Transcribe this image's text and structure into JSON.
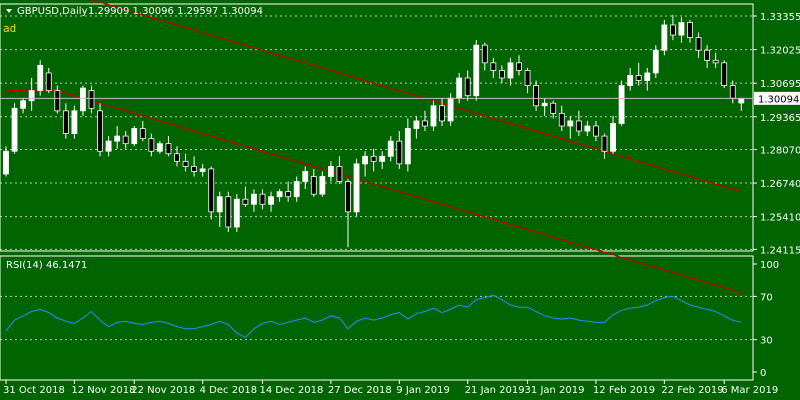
{
  "header": {
    "symbol_label": "GBPUSD,Daily",
    "ohlc_label": "1.29909 1.30096 1.29597 1.30094",
    "watermark": "ad"
  },
  "price_axis": {
    "ticks": [
      "1.33355",
      "1.32025",
      "1.30695",
      "1.29365",
      "1.28070",
      "1.26740",
      "1.25410",
      "1.24115"
    ],
    "current_price": "1.30094"
  },
  "rsi_panel": {
    "title": "RSI(14) 46.1471",
    "ticks": [
      "100",
      "70",
      "30",
      "0"
    ]
  },
  "date_axis": {
    "ticks": [
      "31 Oct 2018",
      "12 Nov 2018",
      "22 Nov 2018",
      "4 Dec 2018",
      "14 Dec 2018",
      "27 Dec 2018",
      "9 Jan 2019",
      "21 Jan 2019",
      "31 Jan 2019",
      "12 Feb 2019",
      "22 Feb 2019",
      "6 Mar 2019"
    ]
  },
  "colors": {
    "background": "#006400",
    "bull_candle": "#ffffff",
    "bear_candle": "#000000",
    "grid": "#ffffff",
    "ma": "#c80000",
    "rsi_line": "#1e90ff",
    "price_label_bg": "#ffffff",
    "price_label_text": "#000000"
  },
  "chart_data": [
    {
      "type": "candlestick",
      "symbol": "GBPUSD",
      "timeframe": "Daily",
      "ylim": [
        1.2405,
        1.3383
      ],
      "candles": [
        [
          1.271,
          1.282,
          1.27,
          1.28
        ],
        [
          1.28,
          1.299,
          1.279,
          1.297
        ],
        [
          1.297,
          1.301,
          1.295,
          1.3
        ],
        [
          1.3,
          1.309,
          1.296,
          1.304
        ],
        [
          1.304,
          1.316,
          1.302,
          1.314
        ],
        [
          1.311,
          1.313,
          1.303,
          1.304
        ],
        [
          1.304,
          1.306,
          1.295,
          1.296
        ],
        [
          1.296,
          1.299,
          1.285,
          1.287
        ],
        [
          1.287,
          1.298,
          1.285,
          1.296
        ],
        [
          1.296,
          1.306,
          1.294,
          1.305
        ],
        [
          1.304,
          1.306,
          1.295,
          1.297
        ],
        [
          1.296,
          1.299,
          1.278,
          1.28
        ],
        [
          1.28,
          1.286,
          1.278,
          1.284
        ],
        [
          1.284,
          1.29,
          1.281,
          1.286
        ],
        [
          1.286,
          1.288,
          1.281,
          1.283
        ],
        [
          1.283,
          1.29,
          1.282,
          1.289
        ],
        [
          1.289,
          1.292,
          1.284,
          1.285
        ],
        [
          1.285,
          1.287,
          1.278,
          1.28
        ],
        [
          1.28,
          1.284,
          1.279,
          1.283
        ],
        [
          1.283,
          1.286,
          1.278,
          1.279
        ],
        [
          1.279,
          1.282,
          1.274,
          1.276
        ],
        [
          1.276,
          1.279,
          1.272,
          1.274
        ],
        [
          1.274,
          1.278,
          1.27,
          1.272
        ],
        [
          1.272,
          1.275,
          1.27,
          1.273
        ],
        [
          1.273,
          1.274,
          1.253,
          1.256
        ],
        [
          1.256,
          1.264,
          1.25,
          1.262
        ],
        [
          1.262,
          1.264,
          1.248,
          1.25
        ],
        [
          1.25,
          1.263,
          1.248,
          1.261
        ],
        [
          1.261,
          1.266,
          1.258,
          1.259
        ],
        [
          1.259,
          1.265,
          1.256,
          1.263
        ],
        [
          1.263,
          1.265,
          1.257,
          1.259
        ],
        [
          1.259,
          1.264,
          1.256,
          1.262
        ],
        [
          1.262,
          1.265,
          1.26,
          1.264
        ],
        [
          1.264,
          1.268,
          1.26,
          1.262
        ],
        [
          1.262,
          1.27,
          1.26,
          1.268
        ],
        [
          1.268,
          1.274,
          1.265,
          1.272
        ],
        [
          1.27,
          1.273,
          1.262,
          1.263
        ],
        [
          1.263,
          1.272,
          1.262,
          1.27
        ],
        [
          1.27,
          1.276,
          1.268,
          1.274
        ],
        [
          1.274,
          1.278,
          1.267,
          1.268
        ],
        [
          1.268,
          1.269,
          1.242,
          1.256
        ],
        [
          1.256,
          1.277,
          1.254,
          1.275
        ],
        [
          1.275,
          1.28,
          1.27,
          1.278
        ],
        [
          1.278,
          1.281,
          1.272,
          1.276
        ],
        [
          1.276,
          1.28,
          1.273,
          1.278
        ],
        [
          1.278,
          1.286,
          1.276,
          1.284
        ],
        [
          1.284,
          1.288,
          1.273,
          1.275
        ],
        [
          1.275,
          1.293,
          1.272,
          1.289
        ],
        [
          1.289,
          1.294,
          1.285,
          1.292
        ],
        [
          1.292,
          1.296,
          1.288,
          1.29
        ],
        [
          1.29,
          1.3,
          1.288,
          1.298
        ],
        [
          1.298,
          1.301,
          1.29,
          1.292
        ],
        [
          1.292,
          1.303,
          1.29,
          1.301
        ],
        [
          1.301,
          1.311,
          1.299,
          1.309
        ],
        [
          1.309,
          1.312,
          1.3,
          1.302
        ],
        [
          1.302,
          1.324,
          1.3,
          1.322
        ],
        [
          1.322,
          1.323,
          1.312,
          1.315
        ],
        [
          1.315,
          1.317,
          1.309,
          1.312
        ],
        [
          1.312,
          1.314,
          1.307,
          1.309
        ],
        [
          1.309,
          1.317,
          1.306,
          1.315
        ],
        [
          1.315,
          1.318,
          1.31,
          1.312
        ],
        [
          1.312,
          1.313,
          1.303,
          1.306
        ],
        [
          1.306,
          1.308,
          1.296,
          1.298
        ],
        [
          1.298,
          1.301,
          1.294,
          1.299
        ],
        [
          1.299,
          1.3,
          1.293,
          1.295
        ],
        [
          1.295,
          1.298,
          1.288,
          1.29
        ],
        [
          1.29,
          1.294,
          1.285,
          1.292
        ],
        [
          1.292,
          1.296,
          1.286,
          1.288
        ],
        [
          1.288,
          1.292,
          1.286,
          1.29
        ],
        [
          1.29,
          1.292,
          1.284,
          1.286
        ],
        [
          1.286,
          1.287,
          1.277,
          1.28
        ],
        [
          1.28,
          1.294,
          1.279,
          1.291
        ],
        [
          1.291,
          1.308,
          1.29,
          1.306
        ],
        [
          1.306,
          1.313,
          1.304,
          1.31
        ],
        [
          1.31,
          1.315,
          1.306,
          1.308
        ],
        [
          1.308,
          1.313,
          1.304,
          1.311
        ],
        [
          1.311,
          1.322,
          1.309,
          1.32
        ],
        [
          1.32,
          1.332,
          1.318,
          1.33
        ],
        [
          1.33,
          1.334,
          1.324,
          1.326
        ],
        [
          1.326,
          1.333,
          1.323,
          1.331
        ],
        [
          1.331,
          1.332,
          1.323,
          1.325
        ],
        [
          1.325,
          1.327,
          1.317,
          1.32
        ],
        [
          1.32,
          1.322,
          1.313,
          1.316
        ],
        [
          1.316,
          1.319,
          1.313,
          1.315
        ],
        [
          1.315,
          1.316,
          1.305,
          1.306
        ],
        [
          1.306,
          1.308,
          1.299,
          1.301
        ],
        [
          1.2991,
          1.301,
          1.296,
          1.3009
        ]
      ],
      "moving_averages": [
        {
          "color": "#c80000",
          "values": [
            1.35,
            1.349,
            1.348,
            1.347,
            1.346,
            1.345,
            1.344,
            1.343,
            1.342,
            1.341,
            1.34,
            1.339,
            1.338,
            1.337,
            1.336,
            1.335,
            1.334,
            1.333,
            1.332,
            1.331,
            1.33,
            1.329,
            1.328,
            1.327,
            1.326,
            1.325,
            1.324,
            1.323,
            1.322,
            1.321,
            1.32,
            1.319,
            1.318,
            1.317,
            1.316,
            1.315,
            1.314,
            1.313,
            1.312,
            1.311,
            1.31,
            1.309,
            1.308,
            1.307,
            1.306,
            1.305,
            1.304,
            1.303,
            1.302,
            1.301,
            1.3,
            1.299,
            1.298,
            1.297,
            1.296,
            1.295,
            1.294,
            1.293,
            1.292,
            1.291,
            1.29,
            1.289,
            1.288,
            1.287,
            1.286,
            1.285,
            1.284,
            1.283,
            1.282,
            1.281,
            1.28,
            1.279,
            1.278,
            1.277,
            1.276,
            1.275,
            1.274,
            1.273,
            1.272,
            1.271,
            1.27,
            1.269,
            1.268,
            1.267,
            1.266,
            1.265,
            1.264
          ]
        },
        {
          "color": "#c80000",
          "values": [
            1.304,
            1.304,
            1.304,
            1.304,
            1.304,
            1.304,
            1.304,
            1.303,
            1.302,
            1.301,
            1.3,
            1.299,
            1.298,
            1.297,
            1.296,
            1.295,
            1.294,
            1.293,
            1.292,
            1.291,
            1.29,
            1.289,
            1.288,
            1.287,
            1.286,
            1.285,
            1.284,
            1.283,
            1.282,
            1.281,
            1.28,
            1.279,
            1.278,
            1.277,
            1.276,
            1.275,
            1.274,
            1.273,
            1.272,
            1.271,
            1.27,
            1.269,
            1.268,
            1.267,
            1.266,
            1.265,
            1.264,
            1.263,
            1.262,
            1.261,
            1.26,
            1.259,
            1.258,
            1.257,
            1.256,
            1.255,
            1.254,
            1.253,
            1.252,
            1.251,
            1.25,
            1.249,
            1.248,
            1.247,
            1.246,
            1.245,
            1.244,
            1.243,
            1.242,
            1.241,
            1.24,
            1.239,
            1.238,
            1.237,
            1.236,
            1.235,
            1.234,
            1.233,
            1.232,
            1.231,
            1.23,
            1.229,
            1.228,
            1.227,
            1.226,
            1.225,
            1.224
          ]
        }
      ]
    },
    {
      "type": "line",
      "title": "RSI(14) 46.1471",
      "ylim": [
        0,
        100
      ],
      "levels": [
        30,
        70
      ],
      "values": [
        38,
        48,
        52,
        56,
        58,
        55,
        50,
        47,
        45,
        50,
        56,
        48,
        42,
        46,
        47,
        45,
        44,
        46,
        47,
        45,
        42,
        40,
        40,
        42,
        44,
        47,
        44,
        36,
        32,
        40,
        45,
        47,
        44,
        46,
        48,
        50,
        46,
        48,
        52,
        50,
        40,
        47,
        50,
        48,
        50,
        53,
        55,
        49,
        54,
        56,
        59,
        55,
        58,
        62,
        60,
        67,
        69,
        71,
        67,
        62,
        60,
        60,
        56,
        52,
        50,
        49,
        50,
        48,
        47,
        46,
        46,
        53,
        57,
        59,
        60,
        62,
        66,
        69,
        70,
        66,
        62,
        60,
        58,
        56,
        52,
        48,
        46
      ]
    }
  ]
}
